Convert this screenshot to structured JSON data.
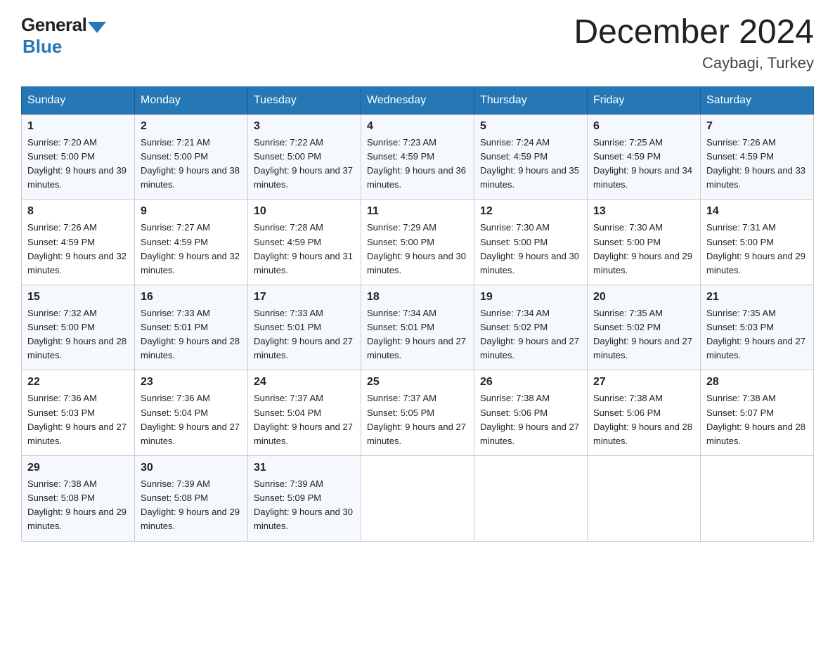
{
  "header": {
    "logo_general": "General",
    "logo_blue": "Blue",
    "title": "December 2024",
    "location": "Caybagi, Turkey"
  },
  "days_of_week": [
    "Sunday",
    "Monday",
    "Tuesday",
    "Wednesday",
    "Thursday",
    "Friday",
    "Saturday"
  ],
  "weeks": [
    [
      {
        "day": "1",
        "sunrise": "Sunrise: 7:20 AM",
        "sunset": "Sunset: 5:00 PM",
        "daylight": "Daylight: 9 hours and 39 minutes."
      },
      {
        "day": "2",
        "sunrise": "Sunrise: 7:21 AM",
        "sunset": "Sunset: 5:00 PM",
        "daylight": "Daylight: 9 hours and 38 minutes."
      },
      {
        "day": "3",
        "sunrise": "Sunrise: 7:22 AM",
        "sunset": "Sunset: 5:00 PM",
        "daylight": "Daylight: 9 hours and 37 minutes."
      },
      {
        "day": "4",
        "sunrise": "Sunrise: 7:23 AM",
        "sunset": "Sunset: 4:59 PM",
        "daylight": "Daylight: 9 hours and 36 minutes."
      },
      {
        "day": "5",
        "sunrise": "Sunrise: 7:24 AM",
        "sunset": "Sunset: 4:59 PM",
        "daylight": "Daylight: 9 hours and 35 minutes."
      },
      {
        "day": "6",
        "sunrise": "Sunrise: 7:25 AM",
        "sunset": "Sunset: 4:59 PM",
        "daylight": "Daylight: 9 hours and 34 minutes."
      },
      {
        "day": "7",
        "sunrise": "Sunrise: 7:26 AM",
        "sunset": "Sunset: 4:59 PM",
        "daylight": "Daylight: 9 hours and 33 minutes."
      }
    ],
    [
      {
        "day": "8",
        "sunrise": "Sunrise: 7:26 AM",
        "sunset": "Sunset: 4:59 PM",
        "daylight": "Daylight: 9 hours and 32 minutes."
      },
      {
        "day": "9",
        "sunrise": "Sunrise: 7:27 AM",
        "sunset": "Sunset: 4:59 PM",
        "daylight": "Daylight: 9 hours and 32 minutes."
      },
      {
        "day": "10",
        "sunrise": "Sunrise: 7:28 AM",
        "sunset": "Sunset: 4:59 PM",
        "daylight": "Daylight: 9 hours and 31 minutes."
      },
      {
        "day": "11",
        "sunrise": "Sunrise: 7:29 AM",
        "sunset": "Sunset: 5:00 PM",
        "daylight": "Daylight: 9 hours and 30 minutes."
      },
      {
        "day": "12",
        "sunrise": "Sunrise: 7:30 AM",
        "sunset": "Sunset: 5:00 PM",
        "daylight": "Daylight: 9 hours and 30 minutes."
      },
      {
        "day": "13",
        "sunrise": "Sunrise: 7:30 AM",
        "sunset": "Sunset: 5:00 PM",
        "daylight": "Daylight: 9 hours and 29 minutes."
      },
      {
        "day": "14",
        "sunrise": "Sunrise: 7:31 AM",
        "sunset": "Sunset: 5:00 PM",
        "daylight": "Daylight: 9 hours and 29 minutes."
      }
    ],
    [
      {
        "day": "15",
        "sunrise": "Sunrise: 7:32 AM",
        "sunset": "Sunset: 5:00 PM",
        "daylight": "Daylight: 9 hours and 28 minutes."
      },
      {
        "day": "16",
        "sunrise": "Sunrise: 7:33 AM",
        "sunset": "Sunset: 5:01 PM",
        "daylight": "Daylight: 9 hours and 28 minutes."
      },
      {
        "day": "17",
        "sunrise": "Sunrise: 7:33 AM",
        "sunset": "Sunset: 5:01 PM",
        "daylight": "Daylight: 9 hours and 27 minutes."
      },
      {
        "day": "18",
        "sunrise": "Sunrise: 7:34 AM",
        "sunset": "Sunset: 5:01 PM",
        "daylight": "Daylight: 9 hours and 27 minutes."
      },
      {
        "day": "19",
        "sunrise": "Sunrise: 7:34 AM",
        "sunset": "Sunset: 5:02 PM",
        "daylight": "Daylight: 9 hours and 27 minutes."
      },
      {
        "day": "20",
        "sunrise": "Sunrise: 7:35 AM",
        "sunset": "Sunset: 5:02 PM",
        "daylight": "Daylight: 9 hours and 27 minutes."
      },
      {
        "day": "21",
        "sunrise": "Sunrise: 7:35 AM",
        "sunset": "Sunset: 5:03 PM",
        "daylight": "Daylight: 9 hours and 27 minutes."
      }
    ],
    [
      {
        "day": "22",
        "sunrise": "Sunrise: 7:36 AM",
        "sunset": "Sunset: 5:03 PM",
        "daylight": "Daylight: 9 hours and 27 minutes."
      },
      {
        "day": "23",
        "sunrise": "Sunrise: 7:36 AM",
        "sunset": "Sunset: 5:04 PM",
        "daylight": "Daylight: 9 hours and 27 minutes."
      },
      {
        "day": "24",
        "sunrise": "Sunrise: 7:37 AM",
        "sunset": "Sunset: 5:04 PM",
        "daylight": "Daylight: 9 hours and 27 minutes."
      },
      {
        "day": "25",
        "sunrise": "Sunrise: 7:37 AM",
        "sunset": "Sunset: 5:05 PM",
        "daylight": "Daylight: 9 hours and 27 minutes."
      },
      {
        "day": "26",
        "sunrise": "Sunrise: 7:38 AM",
        "sunset": "Sunset: 5:06 PM",
        "daylight": "Daylight: 9 hours and 27 minutes."
      },
      {
        "day": "27",
        "sunrise": "Sunrise: 7:38 AM",
        "sunset": "Sunset: 5:06 PM",
        "daylight": "Daylight: 9 hours and 28 minutes."
      },
      {
        "day": "28",
        "sunrise": "Sunrise: 7:38 AM",
        "sunset": "Sunset: 5:07 PM",
        "daylight": "Daylight: 9 hours and 28 minutes."
      }
    ],
    [
      {
        "day": "29",
        "sunrise": "Sunrise: 7:38 AM",
        "sunset": "Sunset: 5:08 PM",
        "daylight": "Daylight: 9 hours and 29 minutes."
      },
      {
        "day": "30",
        "sunrise": "Sunrise: 7:39 AM",
        "sunset": "Sunset: 5:08 PM",
        "daylight": "Daylight: 9 hours and 29 minutes."
      },
      {
        "day": "31",
        "sunrise": "Sunrise: 7:39 AM",
        "sunset": "Sunset: 5:09 PM",
        "daylight": "Daylight: 9 hours and 30 minutes."
      },
      null,
      null,
      null,
      null
    ]
  ]
}
